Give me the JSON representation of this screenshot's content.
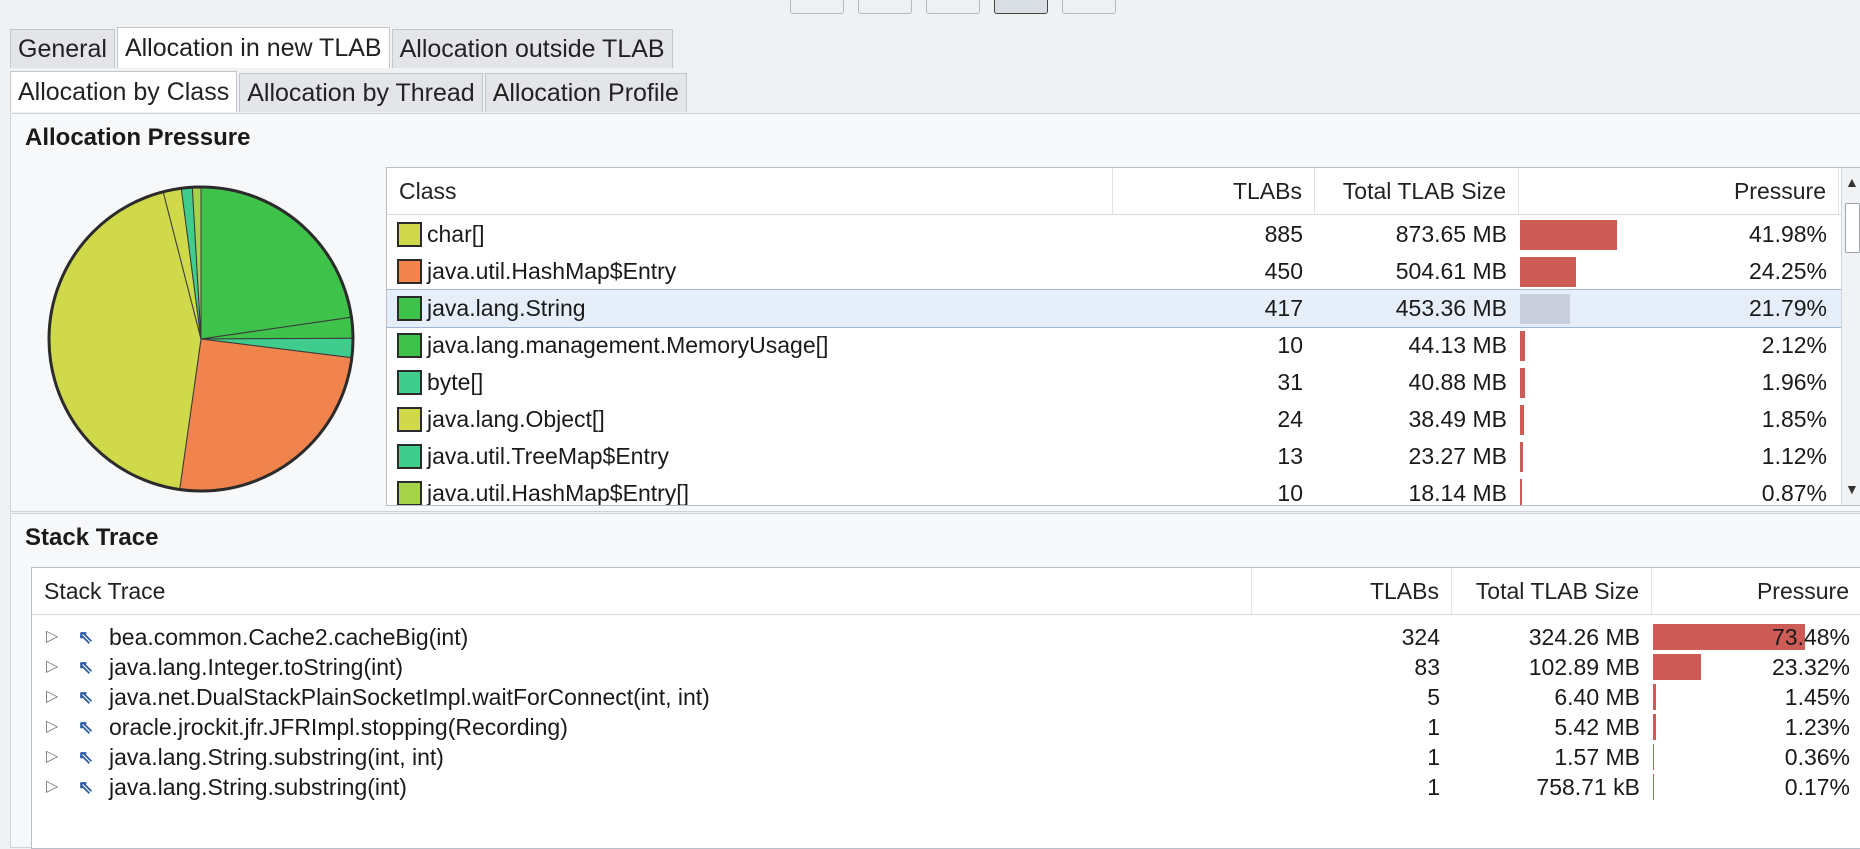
{
  "tabs_main": [
    {
      "label": "General",
      "active": false
    },
    {
      "label": "Allocation in new TLAB",
      "active": true
    },
    {
      "label": "Allocation outside TLAB",
      "active": false
    }
  ],
  "tabs_sub": [
    {
      "label": "Allocation by Class",
      "active": true
    },
    {
      "label": "Allocation by Thread",
      "active": false
    },
    {
      "label": "Allocation Profile",
      "active": false
    }
  ],
  "allocation_panel": {
    "title": "Allocation Pressure"
  },
  "class_table": {
    "headers": {
      "class": "Class",
      "tlabs": "TLABs",
      "size": "Total TLAB Size",
      "pressure": "Pressure"
    },
    "rows": [
      {
        "class": "char[]",
        "tlabs": "885",
        "size": "873.65 MB",
        "pressure": "41.98%",
        "pct": 41.98,
        "color": "#cfd94a"
      },
      {
        "class": "java.util.HashMap$Entry",
        "tlabs": "450",
        "size": "504.61 MB",
        "pressure": "24.25%",
        "pct": 24.25,
        "color": "#f0844c"
      },
      {
        "class": "java.lang.String",
        "tlabs": "417",
        "size": "453.36 MB",
        "pressure": "21.79%",
        "pct": 21.79,
        "color": "#3fc24a",
        "selected": true
      },
      {
        "class": "java.lang.management.MemoryUsage[]",
        "tlabs": "10",
        "size": "44.13 MB",
        "pressure": "2.12%",
        "pct": 2.12,
        "color": "#3fc24a"
      },
      {
        "class": "byte[]",
        "tlabs": "31",
        "size": "40.88 MB",
        "pressure": "1.96%",
        "pct": 1.96,
        "color": "#3fcc8c"
      },
      {
        "class": "java.lang.Object[]",
        "tlabs": "24",
        "size": "38.49 MB",
        "pressure": "1.85%",
        "pct": 1.85,
        "color": "#cfd94a"
      },
      {
        "class": "java.util.TreeMap$Entry",
        "tlabs": "13",
        "size": "23.27 MB",
        "pressure": "1.12%",
        "pct": 1.12,
        "color": "#3fcc8c"
      },
      {
        "class": "java.util.HashMap$Entry[]",
        "tlabs": "10",
        "size": "18.14 MB",
        "pressure": "0.87%",
        "pct": 0.87,
        "color": "#a5d44a"
      }
    ]
  },
  "stack_panel": {
    "title": "Stack Trace"
  },
  "stack_table": {
    "headers": {
      "trace": "Stack Trace",
      "tlabs": "TLABs",
      "size": "Total TLAB Size",
      "pressure": "Pressure"
    },
    "rows": [
      {
        "trace": "bea.common.Cache2.cacheBig(int)",
        "tlabs": "324",
        "size": "324.26 MB",
        "pressure": "73.48%",
        "pct": 73.48
      },
      {
        "trace": "java.lang.Integer.toString(int)",
        "tlabs": "83",
        "size": "102.89 MB",
        "pressure": "23.32%",
        "pct": 23.32
      },
      {
        "trace": "java.net.DualStackPlainSocketImpl.waitForConnect(int, int)",
        "tlabs": "5",
        "size": "6.40 MB",
        "pressure": "1.45%",
        "pct": 1.45
      },
      {
        "trace": "oracle.jrockit.jfr.JFRImpl.stopping(Recording)",
        "tlabs": "1",
        "size": "5.42 MB",
        "pressure": "1.23%",
        "pct": 1.23
      },
      {
        "trace": "java.lang.String.substring(int, int)",
        "tlabs": "1",
        "size": "1.57 MB",
        "pressure": "0.36%",
        "pct": 0.36
      },
      {
        "trace": "java.lang.String.substring(int)",
        "tlabs": "1",
        "size": "758.71 kB",
        "pressure": "0.17%",
        "pct": 0.17
      }
    ]
  },
  "icons": {
    "expander": "expand-triangle-icon",
    "frame": "stack-frame-icon",
    "scroll_up": "scroll-up-icon",
    "scroll_down": "scroll-down-icon"
  },
  "colors": {
    "bar": "#cd5c57",
    "selection": "#e6eef9"
  }
}
